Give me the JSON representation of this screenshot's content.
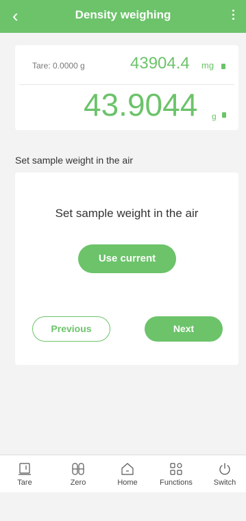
{
  "header": {
    "title": "Density weighing",
    "back_icon": "chevron-left-icon",
    "more_icon": "more-vertical-icon"
  },
  "balance": {
    "tare_text": "Tare: 0.0000 g",
    "mg_value": "43904.4",
    "mg_unit": "mg",
    "g_value": "43.9044",
    "g_unit": "g"
  },
  "section_label": "Set sample weight in the air",
  "step": {
    "instruction": "Set sample weight in the air",
    "use_current_label": "Use current",
    "previous_label": "Previous",
    "next_label": "Next"
  },
  "bottom_nav": {
    "items": [
      {
        "label": "Tare",
        "icon": "tare-icon"
      },
      {
        "label": "Zero",
        "icon": "zero-icon"
      },
      {
        "label": "Home",
        "icon": "home-icon"
      },
      {
        "label": "Functions",
        "icon": "functions-icon"
      },
      {
        "label": "Switch",
        "icon": "power-icon"
      }
    ]
  },
  "colors": {
    "accent": "#6cc36a",
    "background": "#f3f3f3"
  }
}
